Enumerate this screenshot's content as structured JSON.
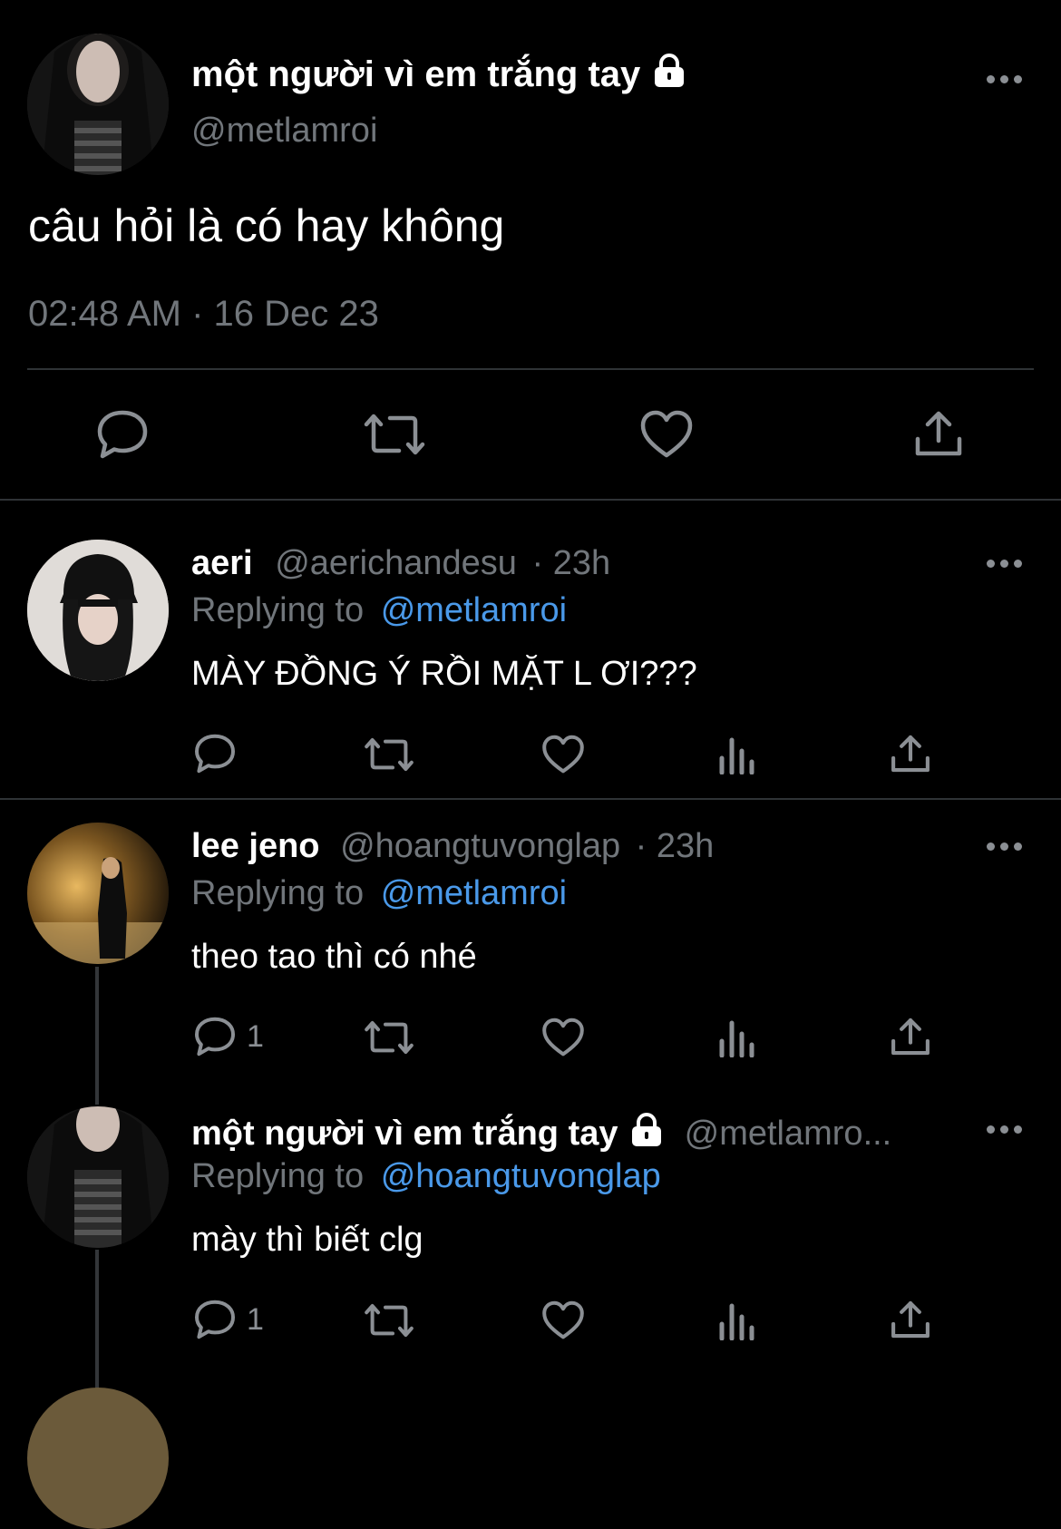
{
  "main_tweet": {
    "display_name": "một người vì em trắng tay",
    "handle": "@metlamroi",
    "text": "câu hỏi là có hay không",
    "timestamp": "02:48 AM · 16 Dec 23",
    "locked": true
  },
  "replies": [
    {
      "display_name": "aeri",
      "handle": "@aerichandesu",
      "time": "· 23h",
      "replying_prefix": "Replying to",
      "replying_to": "@metlamroi",
      "text": "MÀY ĐỒNG Ý RỒI MẶT L ƠI???",
      "reply_count": ""
    },
    {
      "display_name": "lee jeno",
      "handle": "@hoangtuvonglap",
      "time": "· 23h",
      "replying_prefix": "Replying to",
      "replying_to": "@metlamroi",
      "text": "theo tao thì có nhé",
      "reply_count": "1"
    },
    {
      "display_name": "một người vì em trắng tay",
      "handle": "@metlamro...",
      "replying_prefix": "Replying to",
      "replying_to": "@hoangtuvonglap",
      "text": "mày thì biết clg",
      "reply_count": "1",
      "locked": true
    }
  ],
  "icons": {
    "reply": "reply-icon",
    "retweet": "retweet-icon",
    "like": "heart-icon",
    "views": "views-icon",
    "share": "share-icon",
    "more": "more-icon",
    "lock": "lock-icon"
  },
  "colors": {
    "background": "#000000",
    "text": "#ffffff",
    "secondary": "#71767b",
    "link": "#4a99e9",
    "divider": "#2f3336"
  }
}
